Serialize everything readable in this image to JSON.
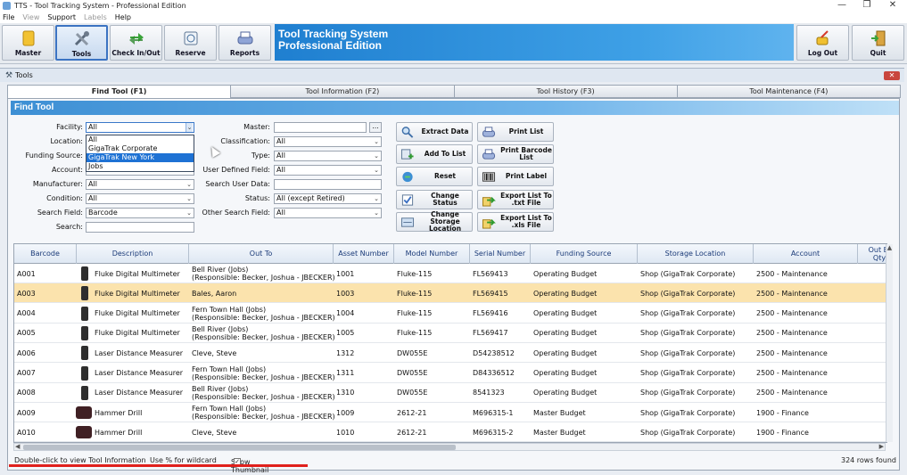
{
  "window": {
    "title": "TTS - Tool Tracking System - Professional Edition",
    "minimize_label": "—",
    "maximize_label": "❐",
    "close_label": "✕"
  },
  "menu": [
    "File",
    "View",
    "Support",
    "Labels",
    "Help"
  ],
  "toolbar": {
    "buttons": [
      {
        "label": "Master",
        "icon": "folder-icon"
      },
      {
        "label": "Tools",
        "icon": "tools-icon"
      },
      {
        "label": "Check In/Out",
        "icon": "arrows-icon"
      },
      {
        "label": "Reserve",
        "icon": "calendar-icon"
      },
      {
        "label": "Reports",
        "icon": "printer-icon"
      }
    ],
    "banner_line1": "Tool Tracking System",
    "banner_line2": "Professional Edition",
    "logout_label": "Log Out",
    "quit_label": "Quit"
  },
  "child_window": {
    "title": "Tools"
  },
  "tabs": [
    "Find Tool (F1)",
    "Tool Information (F2)",
    "Tool History (F3)",
    "Tool Maintenance (F4)"
  ],
  "find": {
    "header": "Find Tool",
    "left_fields": [
      {
        "label": "Facility:",
        "value": "All"
      },
      {
        "label": "Location:",
        "value": ""
      },
      {
        "label": "Funding Source:",
        "value": ""
      },
      {
        "label": "Account:",
        "value": ""
      },
      {
        "label": "Manufacturer:",
        "value": "All"
      },
      {
        "label": "Condition:",
        "value": "All"
      },
      {
        "label": "Search Field:",
        "value": "Barcode"
      },
      {
        "label": "Search:",
        "value": ""
      }
    ],
    "right_fields": [
      {
        "label": "Master:",
        "value": ""
      },
      {
        "label": "Classification:",
        "value": "All"
      },
      {
        "label": "Type:",
        "value": "All"
      },
      {
        "label": "User Defined Field:",
        "value": "All"
      },
      {
        "label": "Search User Data:",
        "value": ""
      },
      {
        "label": "Status:",
        "value": "All  (except Retired)"
      },
      {
        "label": "Other Search Field:",
        "value": "All"
      }
    ],
    "ellipsis": "...",
    "facility_dropdown": [
      "All",
      "GigaTrak Corporate",
      "GigaTrak New York",
      "Jobs"
    ],
    "facility_highlighted": "GigaTrak New York"
  },
  "actions": {
    "extract": "Extract Data",
    "add_to_list": "Add To List",
    "reset": "Reset",
    "change_status": "Change Status",
    "change_storage_1": "Change Storage",
    "change_storage_2": "Location",
    "print_list": "Print List",
    "print_barcode_1": "Print Barcode",
    "print_barcode_2": "List",
    "print_label": "Print Label",
    "export_txt_1": "Export List To",
    "export_txt_2": ".txt File",
    "export_xls_1": "Export List To",
    "export_xls_2": ".xls File"
  },
  "grid": {
    "columns": [
      "Barcode",
      "Description",
      "Out To",
      "Asset Number",
      "Model Number",
      "Serial Number",
      "Funding Source",
      "Storage Location",
      "Account"
    ],
    "last_column_line1": "Out Bi",
    "last_column_line2": "Qty",
    "rows": [
      {
        "barcode": "A001",
        "description": "Fluke Digital Multimeter",
        "out_to_1": "Bell River (Jobs)",
        "out_to_2": "(Responsible: Becker, Joshua - JBECKER)",
        "asset": "1001",
        "model": "Fluke-115",
        "serial": "FL569413",
        "funding": "Operating Budget",
        "storage": "Shop (GigaTrak Corporate)",
        "account": "2500 - Maintenance",
        "thumb": "meter"
      },
      {
        "barcode": "A003",
        "description": "Fluke Digital Multimeter",
        "out_to_1": "Bales, Aaron",
        "out_to_2": "",
        "asset": "1003",
        "model": "Fluke-115",
        "serial": "FL569415",
        "funding": "Operating Budget",
        "storage": "Shop (GigaTrak Corporate)",
        "account": "2500 - Maintenance",
        "thumb": "meter"
      },
      {
        "barcode": "A004",
        "description": "Fluke Digital Multimeter",
        "out_to_1": "Fern Town Hall (Jobs)",
        "out_to_2": "(Responsible: Becker, Joshua - JBECKER)",
        "asset": "1004",
        "model": "Fluke-115",
        "serial": "FL569416",
        "funding": "Operating Budget",
        "storage": "Shop (GigaTrak Corporate)",
        "account": "2500 - Maintenance",
        "thumb": "meter"
      },
      {
        "barcode": "A005",
        "description": "Fluke Digital Multimeter",
        "out_to_1": "Bell River (Jobs)",
        "out_to_2": "(Responsible: Becker, Joshua - JBECKER)",
        "asset": "1005",
        "model": "Fluke-115",
        "serial": "FL569417",
        "funding": "Operating Budget",
        "storage": "Shop (GigaTrak Corporate)",
        "account": "2500 - Maintenance",
        "thumb": "meter"
      },
      {
        "barcode": "A006",
        "description": "Laser Distance Measurer",
        "out_to_1": "Cleve, Steve",
        "out_to_2": "",
        "asset": "1312",
        "model": "DW055E",
        "serial": "D54238512",
        "funding": "Operating Budget",
        "storage": "Shop (GigaTrak Corporate)",
        "account": "2500 - Maintenance",
        "thumb": "laser"
      },
      {
        "barcode": "A007",
        "description": "Laser Distance Measurer",
        "out_to_1": "Fern Town Hall (Jobs)",
        "out_to_2": "(Responsible: Becker, Joshua - JBECKER)",
        "asset": "1311",
        "model": "DW055E",
        "serial": "D84336512",
        "funding": "Operating Budget",
        "storage": "Shop (GigaTrak Corporate)",
        "account": "2500 - Maintenance",
        "thumb": "laser"
      },
      {
        "barcode": "A008",
        "description": "Laser Distance Measurer",
        "out_to_1": "Bell River (Jobs)",
        "out_to_2": "(Responsible: Becker, Joshua - JBECKER)",
        "asset": "1310",
        "model": "DW055E",
        "serial": "8541323",
        "funding": "Operating Budget",
        "storage": "Shop (GigaTrak Corporate)",
        "account": "2500 - Maintenance",
        "thumb": "laser"
      },
      {
        "barcode": "A009",
        "description": "Hammer Drill",
        "out_to_1": "Fern Town Hall (Jobs)",
        "out_to_2": "(Responsible: Becker, Joshua - JBECKER)",
        "asset": "1009",
        "model": "2612-21",
        "serial": "M696315-1",
        "funding": "Master Budget",
        "storage": "Shop (GigaTrak Corporate)",
        "account": "1900 - Finance",
        "thumb": "drill"
      },
      {
        "barcode": "A010",
        "description": "Hammer Drill",
        "out_to_1": "Cleve, Steve",
        "out_to_2": "",
        "asset": "1010",
        "model": "2612-21",
        "serial": "M696315-2",
        "funding": "Master Budget",
        "storage": "Shop (GigaTrak Corporate)",
        "account": "1900 - Finance",
        "thumb": "drill"
      }
    ],
    "selected_row": 1
  },
  "status": {
    "hint1": "Double-click to view Tool Information",
    "hint2": "Use % for wildcard",
    "hint3": "Show Thumbnail Images:",
    "rows_found": "324 rows found"
  },
  "colors": {
    "banner": "#2a8ad8",
    "selected_row": "#fbe3ad",
    "dropdown_highlight": "#1e72d4",
    "header_text": "#1a3a78"
  }
}
